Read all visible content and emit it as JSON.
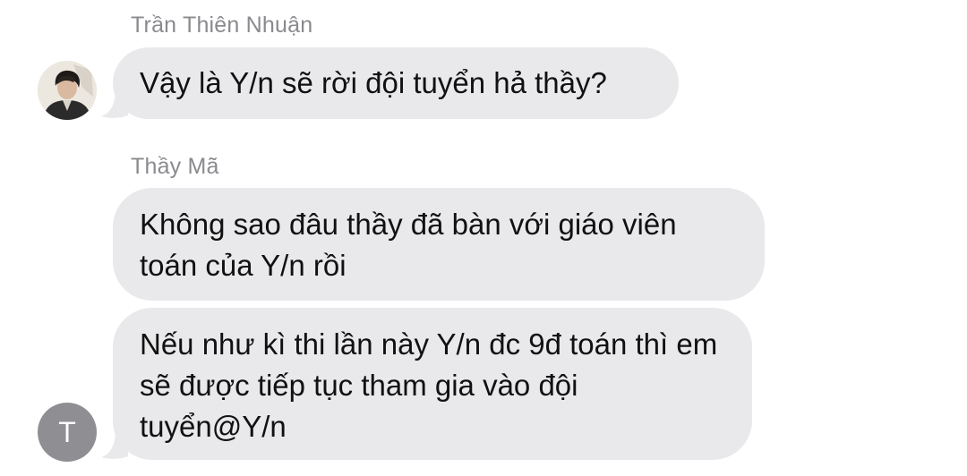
{
  "conversation": {
    "groups": [
      {
        "sender": "Trần Thiên Nhuận",
        "avatar_type": "photo",
        "messages": [
          "Vậy là Y/n sẽ rời đội tuyển hả thầy?"
        ]
      },
      {
        "sender": "Thầy Mã",
        "avatar_type": "initial",
        "avatar_initial": "T",
        "messages": [
          "Không sao đâu thầy đã bàn với giáo viên toán của Y/n rồi",
          "Nếu như kì thi lần này Y/n đc 9đ toán thì em sẽ được tiếp tục tham gia vào đội tuyển@Y/n"
        ]
      }
    ]
  },
  "colors": {
    "bubble_bg": "#e9e9eb",
    "sender_name": "#8a8a8f",
    "avatar_initial_bg": "#8e8e93"
  }
}
